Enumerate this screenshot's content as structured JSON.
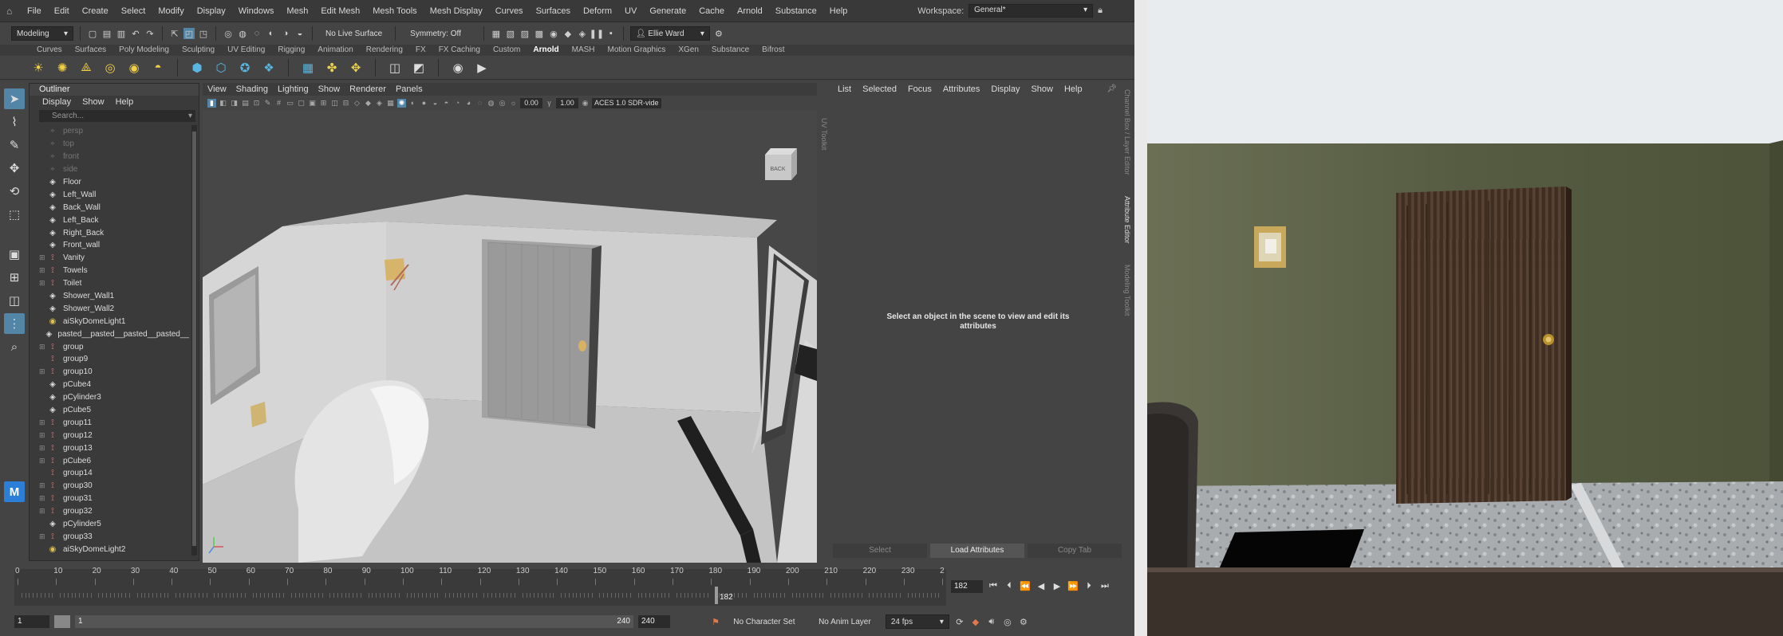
{
  "menubar": {
    "items": [
      "File",
      "Edit",
      "Create",
      "Select",
      "Modify",
      "Display",
      "Windows",
      "Mesh",
      "Edit Mesh",
      "Mesh Tools",
      "Mesh Display",
      "Curves",
      "Surfaces",
      "Deform",
      "UV",
      "Generate",
      "Cache",
      "Arnold",
      "Substance",
      "Help"
    ],
    "workspace_label": "Workspace:",
    "workspace_value": "General*"
  },
  "statusline": {
    "mode": "Modeling",
    "live_surface": "No Live Surface",
    "symmetry": "Symmetry: Off",
    "user": "Ellie Ward"
  },
  "shelf": {
    "tabs": [
      "Curves",
      "Surfaces",
      "Poly Modeling",
      "Sculpting",
      "UV Editing",
      "Rigging",
      "Animation",
      "Rendering",
      "FX",
      "FX Caching",
      "Custom",
      "Arnold",
      "MASH",
      "Motion Graphics",
      "XGen",
      "Substance",
      "Bifrost"
    ],
    "active_tab": "Arnold"
  },
  "outliner": {
    "title": "Outliner",
    "menu": [
      "Display",
      "Show",
      "Help"
    ],
    "search_placeholder": "Search...",
    "items": [
      {
        "name": "persp",
        "type": "camera",
        "dim": true,
        "expandable": false
      },
      {
        "name": "top",
        "type": "camera",
        "dim": true,
        "expandable": false
      },
      {
        "name": "front",
        "type": "camera",
        "dim": true,
        "expandable": false
      },
      {
        "name": "side",
        "type": "camera",
        "dim": true,
        "expandable": false
      },
      {
        "name": "Floor",
        "type": "mesh",
        "dim": false,
        "expandable": false
      },
      {
        "name": "Left_Wall",
        "type": "mesh",
        "dim": false,
        "expandable": false
      },
      {
        "name": "Back_Wall",
        "type": "mesh",
        "dim": false,
        "expandable": false
      },
      {
        "name": "Left_Back",
        "type": "mesh",
        "dim": false,
        "expandable": false
      },
      {
        "name": "Right_Back",
        "type": "mesh",
        "dim": false,
        "expandable": false
      },
      {
        "name": "Front_wall",
        "type": "mesh",
        "dim": false,
        "expandable": false
      },
      {
        "name": "Vanity",
        "type": "group",
        "dim": false,
        "expandable": true
      },
      {
        "name": "Towels",
        "type": "group",
        "dim": false,
        "expandable": true
      },
      {
        "name": "Toilet",
        "type": "group",
        "dim": false,
        "expandable": true
      },
      {
        "name": "Shower_Wall1",
        "type": "mesh",
        "dim": false,
        "expandable": false
      },
      {
        "name": "Shower_Wall2",
        "type": "mesh",
        "dim": false,
        "expandable": false
      },
      {
        "name": "aiSkyDomeLight1",
        "type": "light",
        "dim": false,
        "expandable": false
      },
      {
        "name": "pasted__pasted__pasted__pasted__",
        "type": "mesh",
        "dim": false,
        "expandable": false
      },
      {
        "name": "group",
        "type": "group",
        "dim": false,
        "expandable": true
      },
      {
        "name": "group9",
        "type": "group",
        "dim": false,
        "expandable": false
      },
      {
        "name": "group10",
        "type": "group",
        "dim": false,
        "expandable": true
      },
      {
        "name": "pCube4",
        "type": "mesh",
        "dim": false,
        "expandable": false
      },
      {
        "name": "pCylinder3",
        "type": "mesh",
        "dim": false,
        "expandable": false
      },
      {
        "name": "pCube5",
        "type": "mesh",
        "dim": false,
        "expandable": false
      },
      {
        "name": "group11",
        "type": "group",
        "dim": false,
        "expandable": true
      },
      {
        "name": "group12",
        "type": "group",
        "dim": false,
        "expandable": true
      },
      {
        "name": "group13",
        "type": "group",
        "dim": false,
        "expandable": true
      },
      {
        "name": "pCube6",
        "type": "group",
        "dim": false,
        "expandable": true
      },
      {
        "name": "group14",
        "type": "group",
        "dim": false,
        "expandable": false
      },
      {
        "name": "group30",
        "type": "group",
        "dim": false,
        "expandable": true
      },
      {
        "name": "group31",
        "type": "group",
        "dim": false,
        "expandable": true
      },
      {
        "name": "group32",
        "type": "group",
        "dim": false,
        "expandable": true
      },
      {
        "name": "pCylinder5",
        "type": "mesh",
        "dim": false,
        "expandable": false
      },
      {
        "name": "group33",
        "type": "group",
        "dim": false,
        "expandable": true
      },
      {
        "name": "aiSkyDomeLight2",
        "type": "light",
        "dim": false,
        "expandable": false
      }
    ]
  },
  "viewport": {
    "menu": [
      "View",
      "Shading",
      "Lighting",
      "Show",
      "Renderer",
      "Panels"
    ],
    "exposure": "0.00",
    "gamma": "1.00",
    "color_space": "ACES 1.0 SDR-vide",
    "viewcube_label": "BACK",
    "side_labels": [
      "UV Toolkit"
    ]
  },
  "attribute_editor": {
    "menu": [
      "List",
      "Selected",
      "Focus",
      "Attributes",
      "Display",
      "Show",
      "Help"
    ],
    "message": "Select an object in the scene to view and edit its attributes",
    "buttons": [
      "Select",
      "Load Attributes",
      "Copy Tab"
    ],
    "side_tabs": [
      "Channel Box / Layer Editor",
      "Attribute Editor",
      "Modeling Toolkit"
    ]
  },
  "timeslider": {
    "ticks": [
      "0",
      "10",
      "20",
      "30",
      "40",
      "50",
      "60",
      "70",
      "80",
      "90",
      "100",
      "110",
      "120",
      "130",
      "140",
      "150",
      "160",
      "170",
      "180",
      "190",
      "200",
      "210",
      "220",
      "230",
      "2"
    ],
    "current_frame": "182"
  },
  "range": {
    "start": "1",
    "inner_start": "1",
    "inner_end": "240",
    "end": "240",
    "character_set": "No Character Set",
    "anim_layer": "No Anim Layer",
    "fps": "24 fps"
  },
  "colors": {
    "selected_tool": "#5285a6",
    "wall_render": "#545a40",
    "door_wood": "#4a3628"
  }
}
